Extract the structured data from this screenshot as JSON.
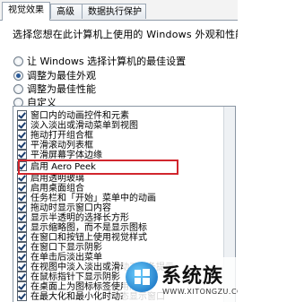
{
  "tabs": [
    {
      "label": "视觉效果",
      "active": true
    },
    {
      "label": "高级",
      "active": false
    },
    {
      "label": "数据执行保护",
      "active": false
    }
  ],
  "instruction": "选择您想在此计算机上使用的 Windows 外观和性能设置。",
  "options": [
    {
      "label": "让 Windows 选择计算机的最佳设置",
      "checked": false
    },
    {
      "label": "调整为最佳外观",
      "checked": true
    },
    {
      "label": "调整为最佳性能",
      "checked": false
    },
    {
      "label": "自定义",
      "checked": false
    }
  ],
  "effects": [
    {
      "label": "窗口内的动画控件和元素",
      "checked": true
    },
    {
      "label": "淡入淡出或滑动菜单到视图",
      "checked": true
    },
    {
      "label": "拖动打开组合框",
      "checked": true
    },
    {
      "label": "平滑滚动列表框",
      "checked": true
    },
    {
      "label": "平滑屏幕字体边缘",
      "checked": true
    },
    {
      "label": "启用 Aero Peek",
      "checked": true
    },
    {
      "label": "启用透明玻璃",
      "checked": true
    },
    {
      "label": "启用桌面组合",
      "checked": true
    },
    {
      "label": "任务栏和「开始」菜单中的动画",
      "checked": true
    },
    {
      "label": "拖动时显示窗口内容",
      "checked": true
    },
    {
      "label": "显示半透明的选择长方形",
      "checked": true
    },
    {
      "label": "显示缩略图，而不是显示图标",
      "checked": true
    },
    {
      "label": "在窗口和按钮上使用视觉样式",
      "checked": true
    },
    {
      "label": "在窗口下显示阴影",
      "checked": true
    },
    {
      "label": "在单击后淡出菜单",
      "checked": true
    },
    {
      "label": "在视图中淡入淡出或滑动工具条提示",
      "checked": true
    },
    {
      "label": "在鼠标指针下显示阴影",
      "checked": true
    },
    {
      "label": "在桌面上为图标标签使用阴影",
      "checked": true
    },
    {
      "label": "在最大化和最小化时动态显示窗口",
      "checked": true
    }
  ],
  "watermark": {
    "title": "系统族",
    "url": "WWW.XITONGZU.COM"
  },
  "colors": {
    "highlight_border": "#d1262d",
    "logo_blue": "#0a63b8"
  }
}
